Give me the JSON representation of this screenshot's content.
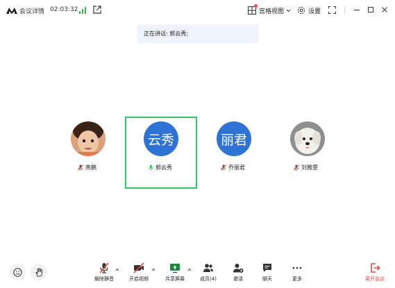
{
  "titlebar": {
    "meeting_details_label": "会议详情",
    "timer": "02:03:32",
    "grid_view_label": "宫格视图",
    "settings_label": "设置"
  },
  "speaker_banner": {
    "text": "正在讲话: 郭云秀;"
  },
  "participants": [
    {
      "name": "燕鹏",
      "muted": true,
      "avatar": "photo-child"
    },
    {
      "name": "郭云秀",
      "muted": false,
      "speaking": true,
      "avatar_text": "云秀"
    },
    {
      "name": "乔丽君",
      "muted": true,
      "avatar_text": "丽君"
    },
    {
      "name": "刘雅雯",
      "muted": true,
      "avatar": "photo-dog"
    }
  ],
  "toolbar": {
    "unmute": "解除静音",
    "start_video": "开启视频",
    "share_screen": "共享屏幕",
    "members": "成员(4)",
    "invite": "邀请",
    "chat": "聊天",
    "more": "更多",
    "leave": "离开会议"
  },
  "colors": {
    "accent": "#2f72d6",
    "speaking_border": "#2fc75f",
    "leave": "#e5483a",
    "banner_bg": "#eef3fc"
  }
}
